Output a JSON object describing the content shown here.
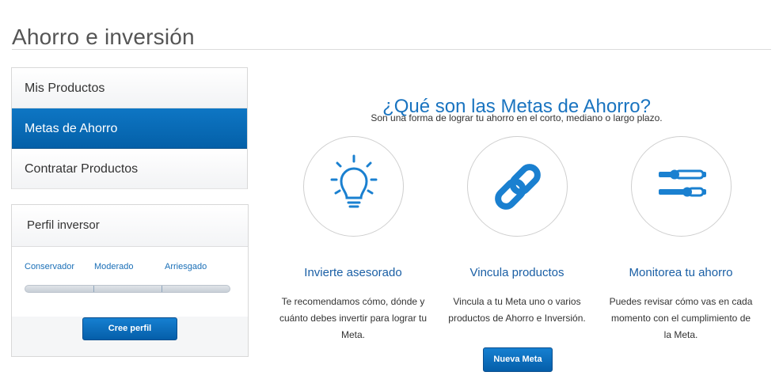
{
  "header": {
    "title": "Ahorro e inversión"
  },
  "sidebar": {
    "items": [
      {
        "label": "Mis Productos",
        "active": false
      },
      {
        "label": "Metas de Ahorro",
        "active": true
      },
      {
        "label": "Contratar Productos",
        "active": false
      }
    ]
  },
  "profile": {
    "title": "Perfil inversor",
    "levels": [
      "Conservador",
      "Moderado",
      "Arriesgado"
    ],
    "button_label": "Cree perfil"
  },
  "main": {
    "title": "¿Qué son las Metas de Ahorro?",
    "subtitle": "Son una forma de lograr tu ahorro en el corto, mediano o largo plazo.",
    "features": [
      {
        "icon": "lightbulb-icon",
        "title": "Invierte asesorado",
        "description": "Te recomendamos cómo, dónde y cuánto debes invertir para lograr tu Meta."
      },
      {
        "icon": "chain-link-icon",
        "title": "Vincula productos",
        "description": "Vincula a tu Meta uno o varios productos de Ahorro e Inversión."
      },
      {
        "icon": "sliders-icon",
        "title": "Monitorea tu ahorro",
        "description": "Puedes revisar cómo vas en cada momento con el cumplimiento de la Meta."
      }
    ],
    "button_label": "Nueva Meta"
  },
  "colors": {
    "accent": "#1a74c0",
    "nav_active": "#0a6bb8",
    "button": "#055ea9"
  }
}
